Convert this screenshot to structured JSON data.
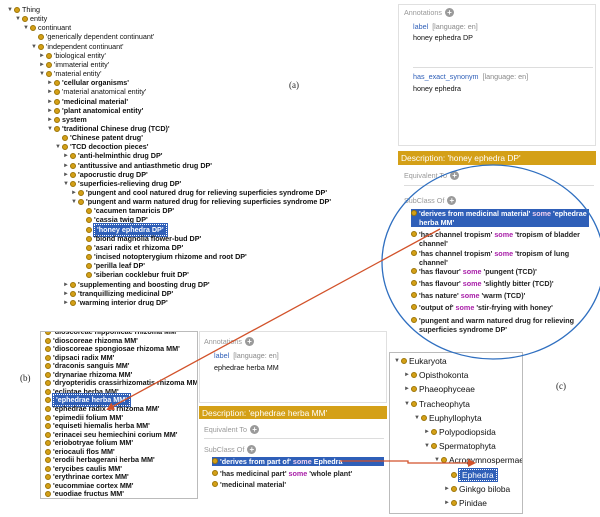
{
  "labels": {
    "a": "(a)",
    "b": "(b)",
    "c": "(c)"
  },
  "accent_colors": {
    "class_dot": "#d4a017",
    "selection": "#2f5fb8",
    "keyword": "#a81ea8",
    "arrow": "#d2522a",
    "circle": "#2f6fc0"
  },
  "tree_a": [
    {
      "text": "Thing",
      "tri": "▼",
      "bold": false
    },
    {
      "text": "entity",
      "tri": "▼",
      "bold": false
    },
    {
      "text": "continuant",
      "tri": "▼",
      "bold": false
    },
    {
      "text": "'generically dependent continuant'",
      "tri": "",
      "bold": false
    },
    {
      "text": "'independent continuant'",
      "tri": "▼",
      "bold": false
    },
    {
      "text": "'biological entity'",
      "tri": "►",
      "bold": false
    },
    {
      "text": "'immaterial entity'",
      "tri": "►",
      "bold": false
    },
    {
      "text": "'material entity'",
      "tri": "▼",
      "bold": false
    },
    {
      "text": "'cellular organisms'",
      "tri": "►",
      "bold": true
    },
    {
      "text": "'material anatomical entity'",
      "tri": "►",
      "bold": false
    },
    {
      "text": "'medicinal material'",
      "tri": "►",
      "bold": true
    },
    {
      "text": "'plant anatomical entity'",
      "tri": "►",
      "bold": true
    },
    {
      "text": "system",
      "tri": "►",
      "bold": true
    },
    {
      "text": "'traditional Chinese drug (TCD)'",
      "tri": "▼",
      "bold": true
    },
    {
      "text": "'Chinese patent drug'",
      "tri": "",
      "bold": true
    },
    {
      "text": "'TCD decoction pieces'",
      "tri": "▼",
      "bold": true
    },
    {
      "text": "'anti-helminthic drug DP'",
      "tri": "►",
      "bold": true
    },
    {
      "text": "'antitussive and antiasthmetic drug DP'",
      "tri": "►",
      "bold": true
    },
    {
      "text": "'apocrustic drug DP'",
      "tri": "►",
      "bold": true
    },
    {
      "text": "'superficies-relieving drug DP'",
      "tri": "▼",
      "bold": true
    },
    {
      "text": "'pungent and cool natured drug for relieving superficies syndrome DP'",
      "tri": "►",
      "bold": true
    },
    {
      "text": "'pungent and warm natured drug for relieving superficies syndrome DP'",
      "tri": "▼",
      "bold": true
    },
    {
      "text": "'cacumen tamaricis DP'",
      "tri": "",
      "bold": true
    },
    {
      "text": "'cassia twig DP'",
      "tri": "",
      "bold": true
    },
    {
      "text": "'honey ephedra DP'",
      "tri": "",
      "bold": true,
      "selected": true
    },
    {
      "text": "'biond magnolia flower-bud DP'",
      "tri": "",
      "bold": true
    },
    {
      "text": "'asari radix et rhizoma DP'",
      "tri": "",
      "bold": true
    },
    {
      "text": "'incised notopterygium rhizome and root DP'",
      "tri": "",
      "bold": true
    },
    {
      "text": "'perilla leaf DP'",
      "tri": "",
      "bold": true
    },
    {
      "text": "'siberian cocklebur fruit DP'",
      "tri": "",
      "bold": true
    },
    {
      "text": "'supplementing and boosting drug DP'",
      "tri": "►",
      "bold": true
    },
    {
      "text": "'tranquillizing medicinal DP'",
      "tri": "►",
      "bold": true
    },
    {
      "text": "'warming interior drug DP'",
      "tri": "►",
      "bold": true
    }
  ],
  "annotations_a": {
    "header": "Annotations",
    "label_key": "label",
    "label_lang": "[language: en]",
    "label_value": "honey ephedra DP",
    "syn_key": "has_exact_synonym",
    "syn_lang": "[language: en]",
    "syn_value": "honey ephedra"
  },
  "description_a": {
    "title": "Description: 'honey ephedra DP'",
    "equivalent": "Equivalent To",
    "subclass": "SubClass Of",
    "rows": [
      {
        "parts": [
          [
            "'derives from medicinal material' ",
            "t"
          ],
          [
            "some",
            "k"
          ],
          [
            " 'ephedrae herba MM'",
            "t"
          ]
        ],
        "selected": true
      },
      {
        "parts": [
          [
            "'has channel tropism' ",
            "t"
          ],
          [
            "some",
            "k"
          ],
          [
            " 'tropism of bladder channel'",
            "t"
          ]
        ]
      },
      {
        "parts": [
          [
            "'has channel tropism' ",
            "t"
          ],
          [
            "some",
            "k"
          ],
          [
            " 'tropism of lung channel'",
            "t"
          ]
        ]
      },
      {
        "parts": [
          [
            "'has flavour' ",
            "t"
          ],
          [
            "some",
            "k"
          ],
          [
            " 'pungent (TCD)'",
            "t"
          ]
        ]
      },
      {
        "parts": [
          [
            "'has flavour' ",
            "t"
          ],
          [
            "some",
            "k"
          ],
          [
            " 'slightly bitter (TCD)'",
            "t"
          ]
        ]
      },
      {
        "parts": [
          [
            "'has nature' ",
            "t"
          ],
          [
            "some",
            "k"
          ],
          [
            " 'warm (TCD)'",
            "t"
          ]
        ]
      },
      {
        "parts": [
          [
            "'output of' ",
            "t"
          ],
          [
            "some",
            "k"
          ],
          [
            " 'stir-frying with honey'",
            "t"
          ]
        ]
      },
      {
        "parts": [
          [
            "'pungent and warm natured drug for relieving superficies syndrome DP'",
            "t"
          ]
        ]
      }
    ]
  },
  "tree_b": [
    {
      "text": "'dioscoreae nipponicae rhizoma MM'",
      "selected": false
    },
    {
      "text": "'dioscoreae rhizoma MM'",
      "selected": false
    },
    {
      "text": "'dioscoreae spongiosae rhizoma MM'",
      "selected": false
    },
    {
      "text": "'dipsaci radix MM'",
      "selected": false
    },
    {
      "text": "'draconis sanguis MM'",
      "selected": false
    },
    {
      "text": "'drynariae rhizoma MM'",
      "selected": false
    },
    {
      "text": "'dryopteridis crassirhizomatis rhizoma MM'",
      "selected": false
    },
    {
      "text": "'ecliptae herba MM'",
      "selected": false
    },
    {
      "text": "'ephedrae herba MM'",
      "selected": true
    },
    {
      "text": "'ephedrae radix et rhizoma MM'",
      "selected": false
    },
    {
      "text": "'epimedii folium MM'",
      "selected": false
    },
    {
      "text": "'equiseti hiemalis herba MM'",
      "selected": false
    },
    {
      "text": "'erinacei seu hemiechini corium MM'",
      "selected": false
    },
    {
      "text": "'eriobotryae folium MM'",
      "selected": false
    },
    {
      "text": "'eriocauli flos MM'",
      "selected": false
    },
    {
      "text": "'erodii herbagerani herba MM'",
      "selected": false
    },
    {
      "text": "'erycibes caulis MM'",
      "selected": false
    },
    {
      "text": "'erythrinae cortex MM'",
      "selected": false
    },
    {
      "text": "'eucommiae cortex MM'",
      "selected": false
    },
    {
      "text": "'euodiae fructus MM'",
      "selected": false
    }
  ],
  "annotations_b": {
    "header": "Annotations",
    "label_key": "label",
    "label_lang": "[language: en]",
    "label_value": "ephedrae herba MM"
  },
  "description_b": {
    "title": "Description: 'ephedrae herba MM'",
    "equivalent": "Equivalent To",
    "subclass": "SubClass Of",
    "rows": [
      {
        "parts": [
          [
            "'derives from part of' ",
            "t"
          ],
          [
            "some",
            "k"
          ],
          [
            " Ephedra",
            "t"
          ]
        ],
        "selected": true
      },
      {
        "parts": [
          [
            "'has medicinal part' ",
            "t"
          ],
          [
            "some",
            "k"
          ],
          [
            " 'whole plant'",
            "t"
          ]
        ]
      },
      {
        "parts": [
          [
            "'medicinal material'",
            "t"
          ]
        ]
      }
    ]
  },
  "tree_c": [
    {
      "text": "Eukaryota",
      "tri": "▼",
      "selected": false
    },
    {
      "text": "Opisthokonta",
      "tri": "►",
      "selected": false
    },
    {
      "text": "Phaeophyceae",
      "tri": "►",
      "selected": false
    },
    {
      "text": "Tracheophyta",
      "tri": "▼",
      "selected": false
    },
    {
      "text": "Euphyllophyta",
      "tri": "▼",
      "selected": false
    },
    {
      "text": "Polypodiopsida",
      "tri": "►",
      "selected": false
    },
    {
      "text": "Spermatophyta",
      "tri": "▼",
      "selected": false
    },
    {
      "text": "Acrogymnospermae",
      "tri": "▼",
      "selected": false
    },
    {
      "text": "Ephedra",
      "tri": "",
      "selected": true
    },
    {
      "text": "Ginkgo biloba",
      "tri": "►",
      "selected": false
    },
    {
      "text": "Pinidae",
      "tri": "►",
      "selected": false
    }
  ]
}
